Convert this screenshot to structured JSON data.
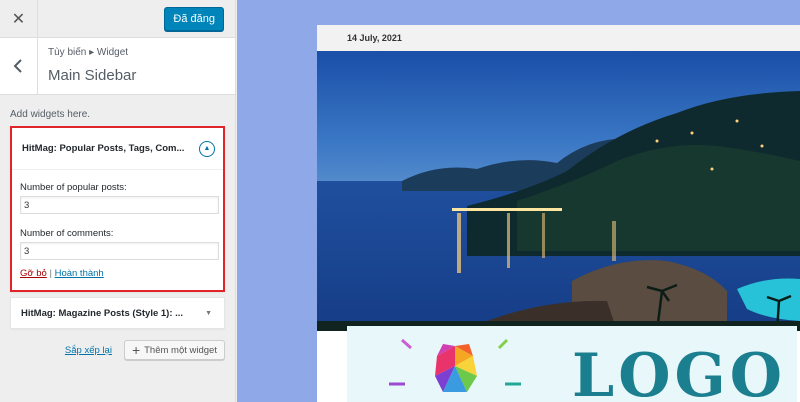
{
  "topbar": {
    "close_icon": "close-icon",
    "close_glyph": "✕",
    "publish_label": "Đã đăng"
  },
  "panel": {
    "breadcrumb": "Tùy biến ▸ Widget",
    "title": "Main Sidebar",
    "description": "Add widgets here."
  },
  "widgets": [
    {
      "title": "HitMag: Popular Posts, Tags, Com...",
      "expanded": true,
      "fields": [
        {
          "label": "Number of popular posts:",
          "value": "3"
        },
        {
          "label": "Number of comments:",
          "value": "3"
        }
      ],
      "remove_label": "Gỡ bỏ",
      "separator": "|",
      "done_label": "Hoàn thành"
    },
    {
      "title": "HitMag: Magazine Posts (Style 1): ...",
      "expanded": false
    }
  ],
  "footer": {
    "reorder_label": "Sắp xếp lại",
    "add_widget_label": "Thêm một widget",
    "add_glyph": "+"
  },
  "preview": {
    "date": "14 July, 2021",
    "image_subject": "night coastal bay photo",
    "logo_text": "LOGO"
  },
  "colors": {
    "accent": "#0085ba",
    "highlight_border": "#e0242a",
    "preview_bg": "#8fa9e8",
    "logo_teal": "#1b7f8f"
  }
}
